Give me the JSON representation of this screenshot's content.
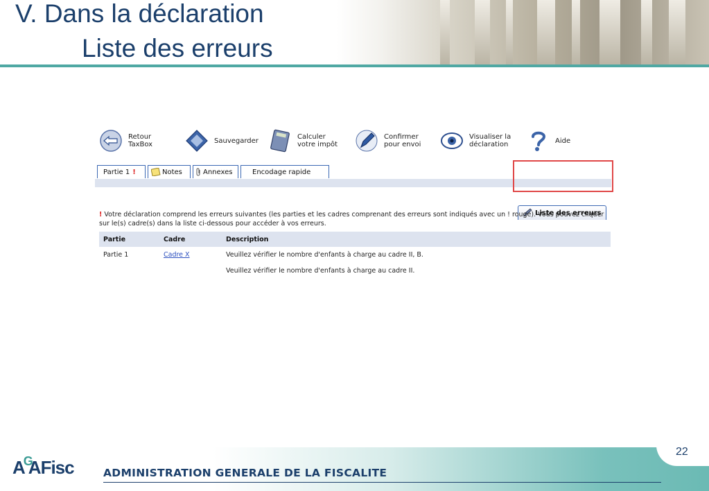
{
  "slide": {
    "title_line1": "V. Dans la déclaration",
    "title_line2": "Liste des erreurs",
    "page_number": "22"
  },
  "toolbar": {
    "back": "Retour\nTaxBox",
    "save": "Sauvegarder",
    "calculate": "Calculer\nvotre impôt",
    "confirm": "Confirmer\npour envoi",
    "view": "Visualiser la\ndéclaration",
    "help": "Aide"
  },
  "tabs": {
    "partie1": "Partie 1",
    "partie1_flag": "!",
    "notes": "Notes",
    "annexes": "Annexes",
    "encodage": "Encodage rapide",
    "errors": "Liste des erreurs"
  },
  "message": {
    "flag": "!",
    "text": "Votre déclaration comprend les erreurs suivantes (les parties et les cadres comprenant des erreurs sont indiqués avec un ! rouge). Vous pouvez cliquer sur le(s) cadre(s) dans la liste ci-dessous pour accéder à vos erreurs."
  },
  "table": {
    "headers": [
      "Partie",
      "Cadre",
      "Description"
    ],
    "rows": [
      [
        "Partie 1",
        "Cadre X",
        "Veuillez vérifier le nombre d'enfants à charge au cadre II, B."
      ],
      [
        "",
        "",
        "Veuillez vérifier le nombre d'enfants à charge au cadre II."
      ]
    ]
  },
  "footer": {
    "logo_a": "A",
    "logo_g": "G",
    "logo_rest": "AFisc",
    "org": "ADMINISTRATION GENERALE DE LA FISCALITE"
  },
  "colors": {
    "title_blue": "#1b3f6b",
    "accent_teal": "#4fa8a3",
    "highlight_red": "#e04747",
    "link_blue": "#2b4fbf"
  }
}
